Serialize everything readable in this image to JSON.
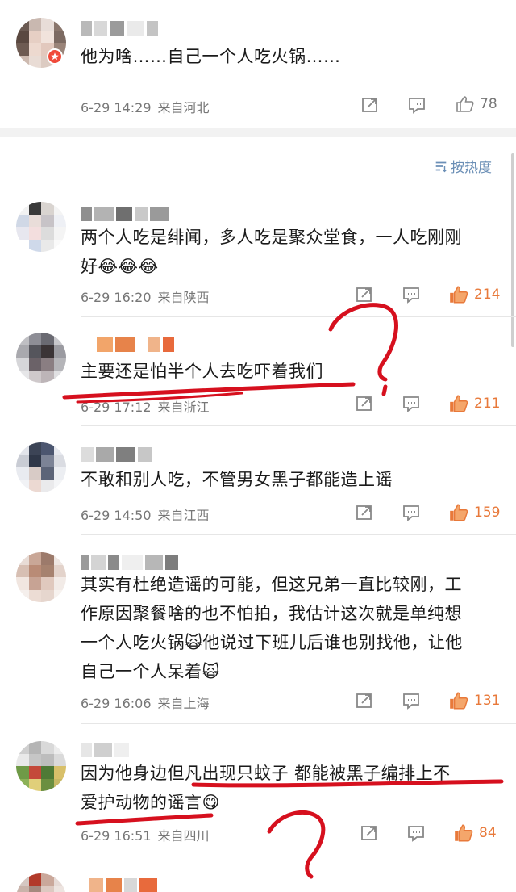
{
  "colors": {
    "accent_like": "#e8793a",
    "meta_gray": "#777777",
    "link_blue": "#6b8fb6",
    "annotation_red": "#d6101e",
    "badge_red": "#f04a3a"
  },
  "top_comment": {
    "text": "他为啥……自己一个人吃火锅……",
    "time": "6-29 14:29",
    "region": "来自河北",
    "likes": "78"
  },
  "sort_label": "按热度",
  "comments": [
    {
      "text_lines": [
        "两个人吃是绯闻，多人吃是聚众堂食，一人吃刚刚",
        "好😂😂😂"
      ],
      "time": "6-29 16:20",
      "region": "来自陕西",
      "likes": "214"
    },
    {
      "text_lines": [
        "主要还是怕半个人去吃吓着我们"
      ],
      "time": "6-29 17:12",
      "region": "来自浙江",
      "likes": "211"
    },
    {
      "text_lines": [
        "不敢和别人吃，不管男女黑子都能造上谣"
      ],
      "time": "6-29 14:50",
      "region": "来自江西",
      "likes": "159"
    },
    {
      "text_lines": [
        "其实有杜绝造谣的可能，但这兄弟一直比较刚，工",
        "作原因聚餐啥的也不怕拍，我估计这次就是单纯想",
        "一个人吃火锅🙀他说过下班儿后谁也别找他，让他",
        "自己一个人呆着🙀"
      ],
      "time": "6-29 16:06",
      "region": "来自上海",
      "likes": "131"
    },
    {
      "text_lines": [
        "因为他身边但凡出现只蚊子   都能被黑子编排上不",
        "爱护动物的谣言😋"
      ],
      "time": "6-29 16:51",
      "region": "来自四川",
      "likes": "84"
    }
  ],
  "icons": {
    "share": "share-icon",
    "comment": "comment-icon",
    "like": "thumbs-up-icon",
    "sort": "sort-icon"
  }
}
